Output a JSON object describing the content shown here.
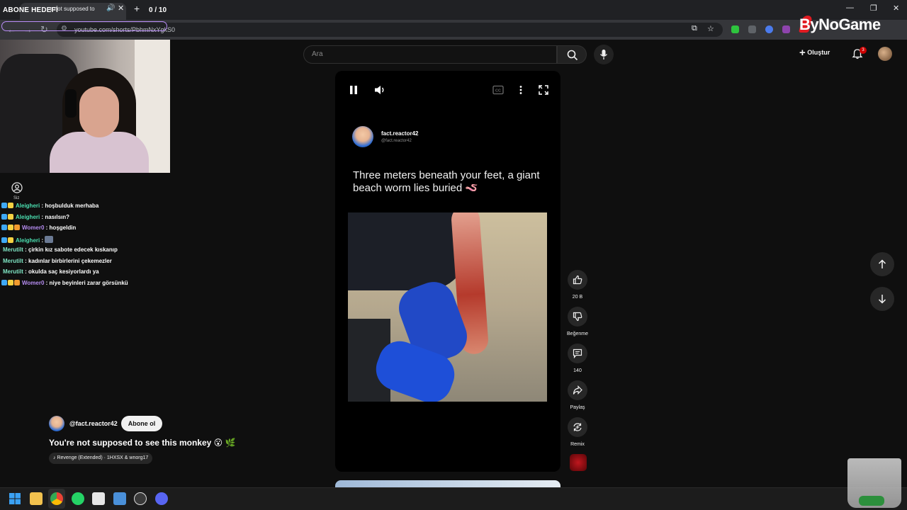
{
  "overlay": {
    "goal_label": "ABONE HEDEFİ",
    "goal_count": "0 / 10"
  },
  "browser": {
    "tab_title": "e not supposed to",
    "url": "youtube.com/shorts/PbhmNxYgkS0"
  },
  "sponsor": {
    "brand": "ByNoGame"
  },
  "chat": {
    "you_label": "Siz",
    "messages": [
      {
        "user": "Aleigheri",
        "text": ": hoşbulduk merhaba",
        "color": "#4be0b1"
      },
      {
        "user": "Aleigheri",
        "text": ": nasılsın?",
        "color": "#4be0b1"
      },
      {
        "user": "Womer0",
        "text": ": hoşgeldin",
        "color": "#b58cf0"
      },
      {
        "user": "Aleigheri",
        "text": ":",
        "color": "#4be0b1"
      },
      {
        "user": "Merutilt",
        "text": ": çirkin kız sabote edecek kıskanıp",
        "color": "#7fe5c4"
      },
      {
        "user": "Merutilt",
        "text": ": kadınlar birbirlerini çekemezler",
        "color": "#7fe5c4"
      },
      {
        "user": "Merutilt",
        "text": ": okulda saç kesiyorlardı ya",
        "color": "#7fe5c4"
      },
      {
        "user": "Womer0",
        "text": ": niye beyinleri zarar görsünkü",
        "color": "#b58cf0"
      }
    ]
  },
  "youtube": {
    "search_placeholder": "Ara",
    "create_label": "Oluştur",
    "notification_count": "3"
  },
  "video": {
    "creator_name": "fact.reactor42",
    "creator_handle": "@fact.reactor42",
    "caption": "Three meters beneath your feet, a giant beach worm lies buried 🪱"
  },
  "actions": {
    "likes": "20 B",
    "dislike_label": "Beğenme",
    "comments": "140",
    "share_label": "Paylaş",
    "remix_label": "Remix"
  },
  "short_meta": {
    "handle": "@fact.reactor42",
    "subscribe_label": "Abone ol",
    "title": "You're not supposed to see this monkey 😮 🌿",
    "music": "Revenge (Extended) · 1HXSX & wnorg17"
  },
  "colors": {
    "accent_red": "#cc0000",
    "goal_border": "#b98df7",
    "background": "#0f0f0f"
  }
}
